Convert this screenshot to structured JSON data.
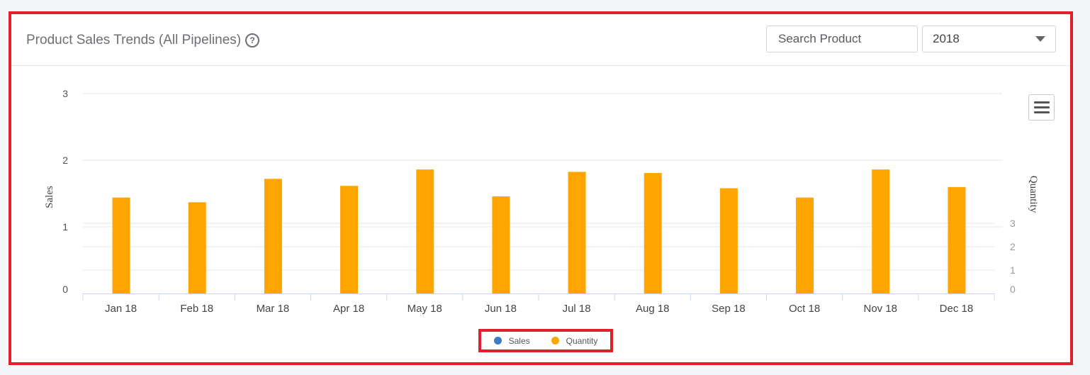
{
  "header": {
    "title": "Product Sales Trends (All Pipelines)",
    "help_glyph": "?",
    "search_placeholder": "Search Product",
    "year_selected": "2018"
  },
  "colors": {
    "sales": "#3b7dc1",
    "quantity": "#ffa500",
    "frame": "#e21f2b"
  },
  "chart_data": {
    "type": "bar",
    "categories": [
      "Jan 18",
      "Feb 18",
      "Mar 18",
      "Apr 18",
      "May 18",
      "Jun 18",
      "Jul 18",
      "Aug 18",
      "Sep 18",
      "Oct 18",
      "Nov 18",
      "Dec 18"
    ],
    "series": [
      {
        "name": "Sales",
        "axis": "left",
        "values": [
          0,
          0,
          0,
          0,
          0,
          0,
          0,
          0,
          0,
          0,
          0,
          0
        ]
      },
      {
        "name": "Quantity",
        "axis": "right",
        "values": [
          4.1,
          3.9,
          4.9,
          4.6,
          5.3,
          4.15,
          5.2,
          5.15,
          4.5,
          4.1,
          5.3,
          4.55
        ]
      }
    ],
    "ylabel_left": "Sales",
    "ylabel_right": "Quantity",
    "ylim_left": [
      0,
      3
    ],
    "ylim_right": [
      0,
      3
    ],
    "yticks_left": [
      "0",
      "1",
      "2",
      "3"
    ],
    "yticks_right": [
      "0",
      "1",
      "2",
      "3"
    ],
    "legend_position": "bottom-center",
    "grid": true
  }
}
